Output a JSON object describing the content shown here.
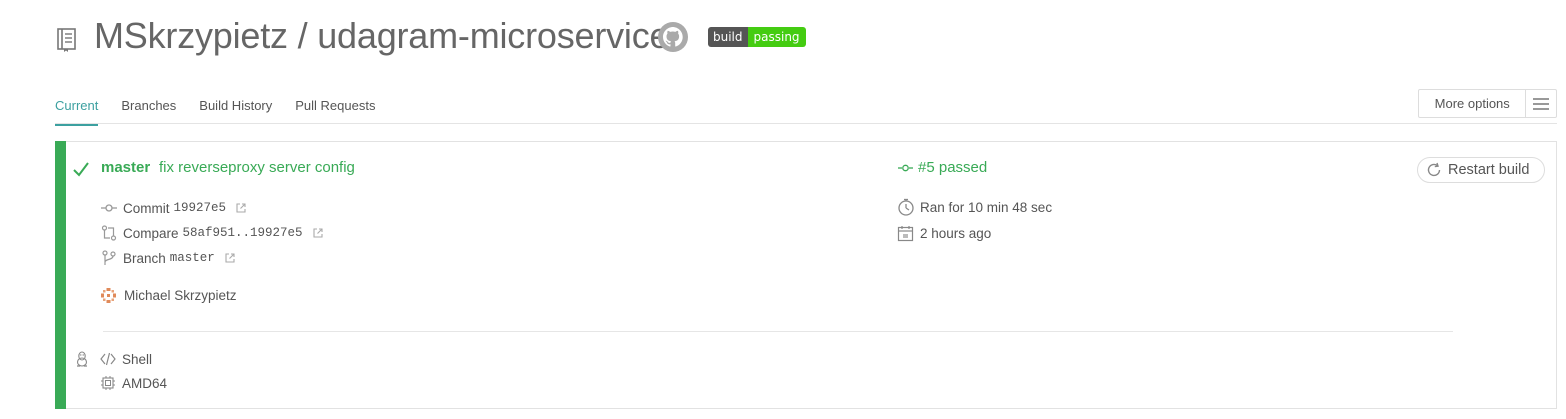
{
  "header": {
    "repo_title": "MSkrzypietz / udagram-microservice",
    "badge": {
      "left": "build",
      "right": "passing"
    }
  },
  "tabs": [
    {
      "label": "Current",
      "active": true
    },
    {
      "label": "Branches",
      "active": false
    },
    {
      "label": "Build History",
      "active": false
    },
    {
      "label": "Pull Requests",
      "active": false
    }
  ],
  "more_options_label": "More options",
  "build": {
    "status": "passed",
    "branch": "master",
    "commit_message": "fix reverseproxy server config",
    "number_label": "#5 passed",
    "restart_label": "Restart build",
    "commit": {
      "label": "Commit",
      "sha": "19927e5"
    },
    "compare": {
      "label": "Compare",
      "range": "58af951..19927e5"
    },
    "branch_row": {
      "label": "Branch",
      "name": "master"
    },
    "author": "Michael Skrzypietz",
    "duration": "Ran for 10 min 48 sec",
    "finished": "2 hours ago",
    "language": "Shell",
    "arch": "AMD64"
  },
  "colors": {
    "passed": "#39aa56",
    "active_tab": "#3ca0a0",
    "badge_left": "#555555",
    "badge_right": "#44cc11"
  },
  "icons": [
    "repo-icon",
    "github-icon",
    "check-icon",
    "commit-icon",
    "compare-icon",
    "branch-icon",
    "external-link-icon",
    "avatar",
    "stopwatch-icon",
    "calendar-icon",
    "code-icon",
    "cpu-icon",
    "linux-icon",
    "restart-icon",
    "hamburger-menu-icon"
  ]
}
